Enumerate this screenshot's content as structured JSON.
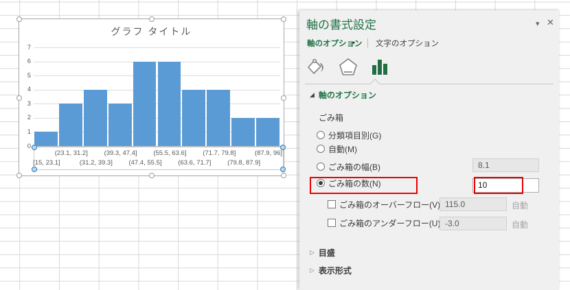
{
  "colors": {
    "excel_green": "#217346",
    "bar_blue": "#5B9BD5",
    "annotation_red": "#e80000",
    "panel_bg": "#f0f0f0"
  },
  "chart_data": {
    "type": "bar",
    "subtype": "histogram",
    "title": "グラフ タイトル",
    "categories": [
      "[15, 23.1]",
      "(23.1, 31.2]",
      "(31.2, 39.3]",
      "(39.3, 47.4]",
      "(47.4, 55.5]",
      "(55.5, 63.6]",
      "(63.6, 71.7]",
      "(71.7, 79.8]",
      "(79.8, 87.9]",
      "(87.9, 96]"
    ],
    "values": [
      1,
      3,
      4,
      3,
      6,
      6,
      4,
      4,
      2,
      2
    ],
    "xlabel": "",
    "ylabel": "",
    "ylim": [
      0,
      7
    ],
    "yticks": [
      0,
      1,
      2,
      3,
      4,
      5,
      6,
      7
    ],
    "grid": true,
    "legend": false,
    "bar_color": "#5B9BD5"
  },
  "panel": {
    "title": "軸の書式設定",
    "window_icons": {
      "collapse": "▾",
      "close": "✕"
    },
    "tabs": [
      {
        "label": "軸のオプション",
        "caret": "▾",
        "selected": true
      },
      {
        "label": "文字のオプション",
        "selected": false
      }
    ],
    "icon_tabs": [
      {
        "name": "fill-line"
      },
      {
        "name": "effects"
      },
      {
        "name": "axis-options",
        "selected": true
      }
    ],
    "section_header": {
      "marker": "◢",
      "label": "軸のオプション"
    },
    "bins_label": "ごみ箱",
    "options": [
      {
        "type": "radio",
        "label": "分類項目別(G)",
        "checked": false
      },
      {
        "type": "radio",
        "label": "自動(M)",
        "checked": false
      },
      {
        "type": "radio",
        "label": "ごみ箱の幅(B)",
        "checked": false,
        "value": "8.1"
      },
      {
        "type": "radio",
        "label": "ごみ箱の数(N)",
        "checked": true,
        "value": "10",
        "highlighted": true
      },
      {
        "type": "checkbox",
        "label": "ごみ箱のオーバーフロー(V)",
        "checked": false,
        "value": "115.0",
        "suffix": "自動"
      },
      {
        "type": "checkbox",
        "label": "ごみ箱のアンダーフロー(U)",
        "checked": false,
        "value": "-3.0",
        "suffix": "自動"
      }
    ],
    "auto_label": "自動",
    "collapsed_sections": [
      {
        "marker": "▷",
        "label": "目盛"
      },
      {
        "marker": "▷",
        "label": "表示形式"
      }
    ]
  }
}
